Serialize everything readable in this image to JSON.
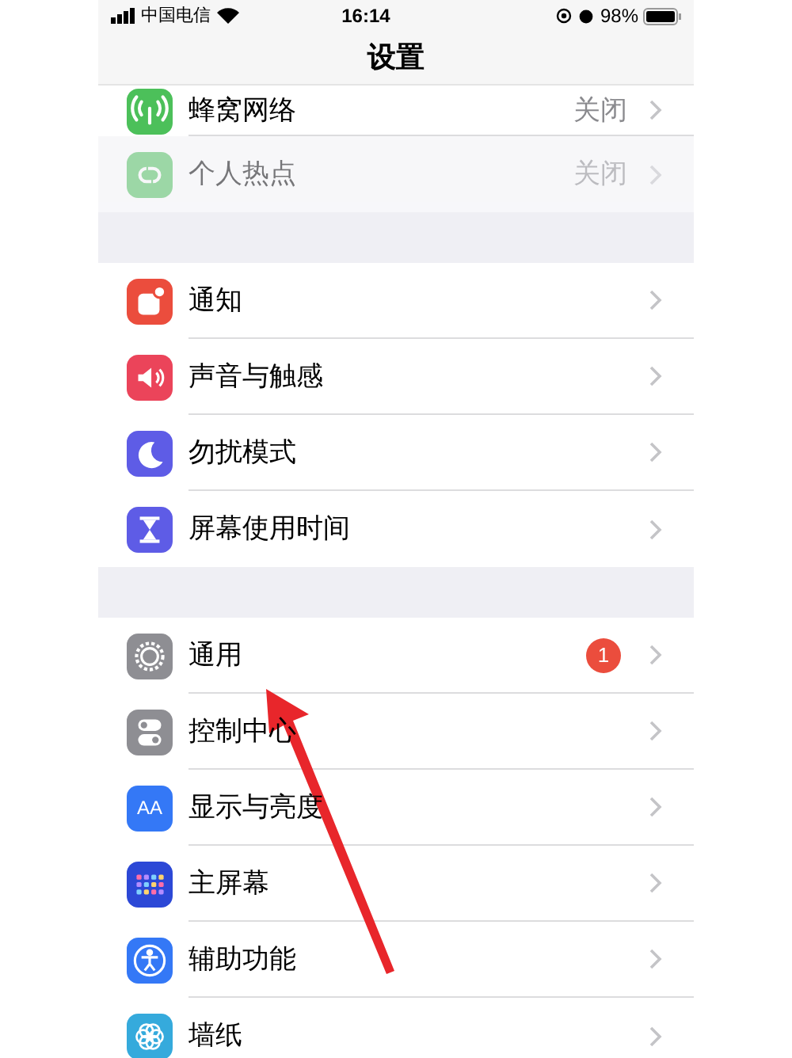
{
  "status_bar": {
    "carrier": "中国电信",
    "time": "16:14",
    "battery": "98%"
  },
  "nav": {
    "title": "设置"
  },
  "groups": [
    {
      "items": [
        {
          "label": "蜂窝网络",
          "value": "关闭",
          "disabled": false
        },
        {
          "label": "个人热点",
          "value": "关闭",
          "disabled": true
        }
      ]
    },
    {
      "items": [
        {
          "label": "通知",
          "disabled": false
        },
        {
          "label": "声音与触感",
          "disabled": false
        },
        {
          "label": "勿扰模式",
          "disabled": false
        },
        {
          "label": "屏幕使用时间",
          "disabled": false
        }
      ]
    },
    {
      "items": [
        {
          "label": "通用",
          "badge": "1",
          "disabled": false
        },
        {
          "label": "控制中心",
          "disabled": false
        },
        {
          "icon_text": "AA",
          "label": "显示与亮度",
          "disabled": false
        },
        {
          "label": "主屏幕",
          "disabled": false
        },
        {
          "label": "辅助功能",
          "disabled": false
        },
        {
          "label": "墙纸",
          "disabled": false
        }
      ]
    }
  ]
}
